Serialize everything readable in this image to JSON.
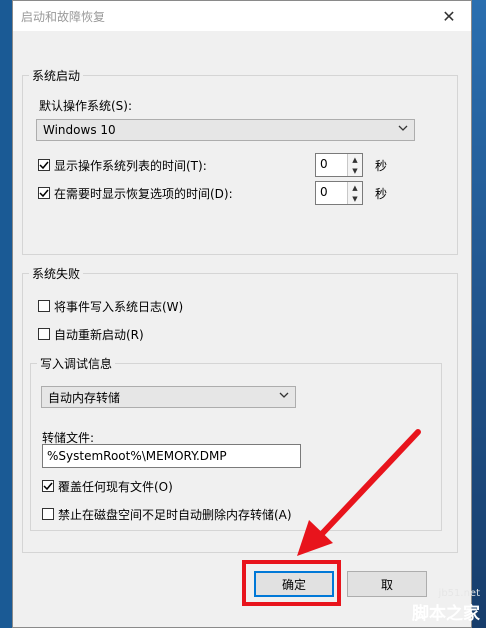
{
  "dialog": {
    "title": "启动和故障恢复",
    "close_glyph": "✕"
  },
  "system_startup": {
    "legend": "系统启动",
    "default_os_label": "默认操作系统(S):",
    "default_os_value": "Windows 10",
    "show_os_list": {
      "label": "显示操作系统列表的时间(T):",
      "checked": true,
      "value": "0"
    },
    "show_recovery": {
      "label": "在需要时显示恢复选项的时间(D):",
      "checked": true,
      "value": "0"
    },
    "seconds_unit": "秒"
  },
  "system_failure": {
    "legend": "系统失败",
    "write_event_log": {
      "label": "将事件写入系统日志(W)",
      "checked": false
    },
    "auto_restart": {
      "label": "自动重新启动(R)",
      "checked": false
    },
    "debug_info": {
      "legend": "写入调试信息",
      "dump_type_value": "自动内存转储",
      "dump_file_label": "转储文件:",
      "dump_file_value": "%SystemRoot%\\MEMORY.DMP",
      "overwrite": {
        "label": "覆盖任何现有文件(O)",
        "checked": true
      },
      "disable_auto_delete": {
        "label": "禁止在磁盘空间不足时自动删除内存转储(A)",
        "checked": false
      }
    }
  },
  "buttons": {
    "ok_label": "确定",
    "cancel_label": "取"
  },
  "watermark": {
    "url": "jb51.net",
    "name": "脚本之家"
  },
  "annotation": {
    "color": "#e8141c"
  }
}
